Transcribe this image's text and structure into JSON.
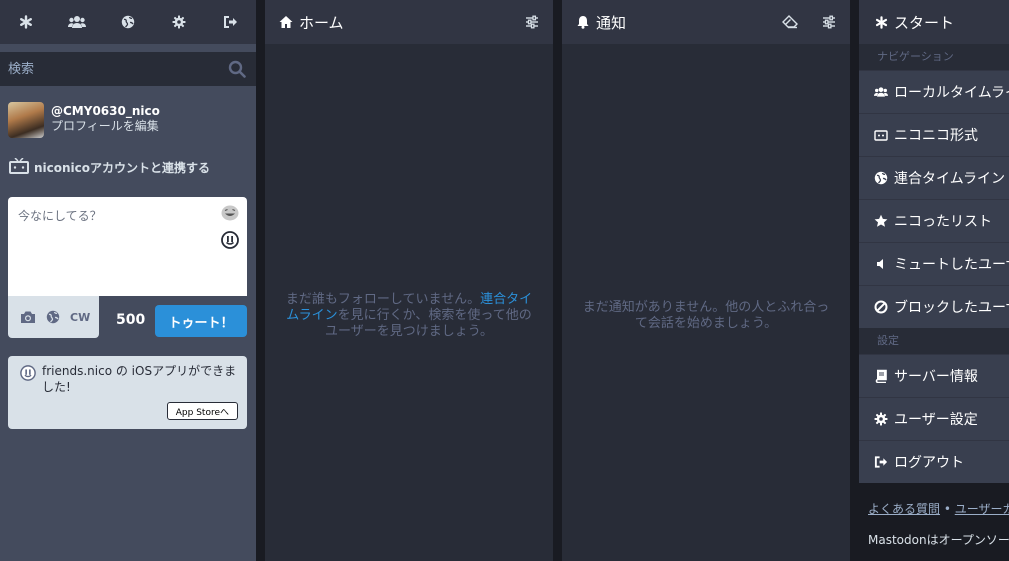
{
  "drawer": {
    "tabs": [
      {
        "icon": "asterisk-icon"
      },
      {
        "icon": "users-icon"
      },
      {
        "icon": "globe-icon"
      },
      {
        "icon": "gear-icon"
      },
      {
        "icon": "sign-out-icon"
      }
    ],
    "search_placeholder": "検索",
    "account": {
      "handle": "@CMY0630_nico",
      "edit_profile": "プロフィールを編集"
    },
    "niconico_link": "niconicoアカウントと連携する",
    "compose": {
      "placeholder": "今なにしてる？",
      "cw_label": "CW",
      "char_count": "500",
      "toot_label": "トゥート！"
    },
    "ios_card": {
      "text": "friends.nico の iOSアプリができました!",
      "button": "App Storeへ"
    }
  },
  "home": {
    "title": "ホーム",
    "empty_prefix": "まだ誰もフォローしていません。",
    "empty_link": "連合タイムライン",
    "empty_suffix": "を見に行くか、検索を使って他のユーザーを見つけましょう。"
  },
  "notifications": {
    "title": "通知",
    "empty": "まだ通知がありません。他の人とふれ合って会話を始めましょう。"
  },
  "start": {
    "title": "スタート",
    "nav_heading": "ナビゲーション",
    "nav_items": [
      {
        "label": "ローカルタイムライン",
        "icon": "users-icon"
      },
      {
        "label": "ニコニコ形式",
        "icon": "tv-icon"
      },
      {
        "label": "連合タイムライン",
        "icon": "globe-icon"
      },
      {
        "label": "ニコったリスト",
        "icon": "star-icon"
      },
      {
        "label": "ミュートしたユーザー",
        "icon": "volume-off-icon"
      },
      {
        "label": "ブロックしたユーザー",
        "icon": "ban-icon"
      }
    ],
    "settings_heading": "設定",
    "settings_items": [
      {
        "label": "サーバー情報",
        "icon": "book-icon"
      },
      {
        "label": "ユーザー設定",
        "icon": "gear-icon"
      },
      {
        "label": "ログアウト",
        "icon": "sign-out-icon"
      }
    ],
    "footer_faq": "よくある質問",
    "footer_sep": "•",
    "footer_guide": "ユーザーガイド",
    "footer_text": "Mastodonはオープンソースソフトウェアです。"
  },
  "colors": {
    "accent": "#2b90d9",
    "drawer_bg": "#444b5d",
    "column_bg": "#282c37",
    "header_bg": "#313543"
  }
}
